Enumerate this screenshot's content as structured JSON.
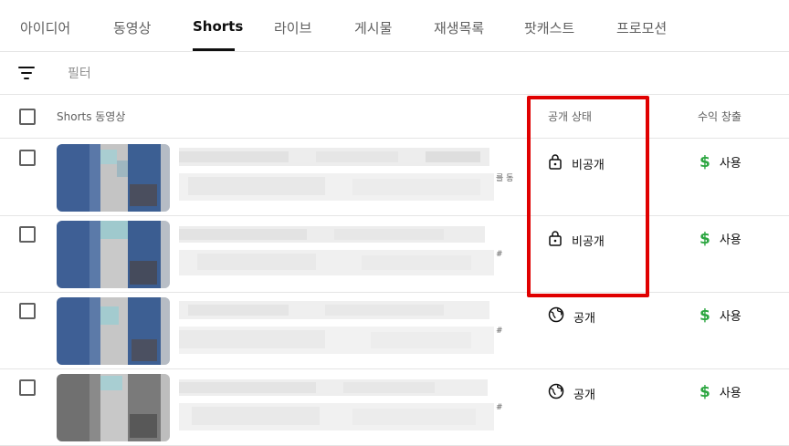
{
  "tabs": [
    {
      "label": "아이디어"
    },
    {
      "label": "동영상"
    },
    {
      "label": "Shorts",
      "active": true
    },
    {
      "label": "라이브"
    },
    {
      "label": "게시물"
    },
    {
      "label": "재생목록"
    },
    {
      "label": "팟캐스트"
    },
    {
      "label": "프로모션"
    }
  ],
  "filter": {
    "placeholder": "필터",
    "icon": "filter-icon"
  },
  "table": {
    "headers": {
      "video": "Shorts 동영상",
      "visibility": "공개 상태",
      "monetization": "수익 창출"
    },
    "rows": [
      {
        "visibility": "비공개",
        "visibility_icon": "lock-icon",
        "monetization": "사용",
        "edge_text": "를 동"
      },
      {
        "visibility": "비공개",
        "visibility_icon": "lock-icon",
        "monetization": "사용",
        "edge_text": "#"
      },
      {
        "visibility": "공개",
        "visibility_icon": "globe-icon",
        "monetization": "사용",
        "edge_text": "#"
      },
      {
        "visibility": "공개",
        "visibility_icon": "globe-icon",
        "monetization": "사용",
        "edge_text": "#"
      }
    ]
  },
  "colors": {
    "highlight": "#e00000",
    "monetization_icon": "#2ba640",
    "accent": "#0f0f0f"
  }
}
